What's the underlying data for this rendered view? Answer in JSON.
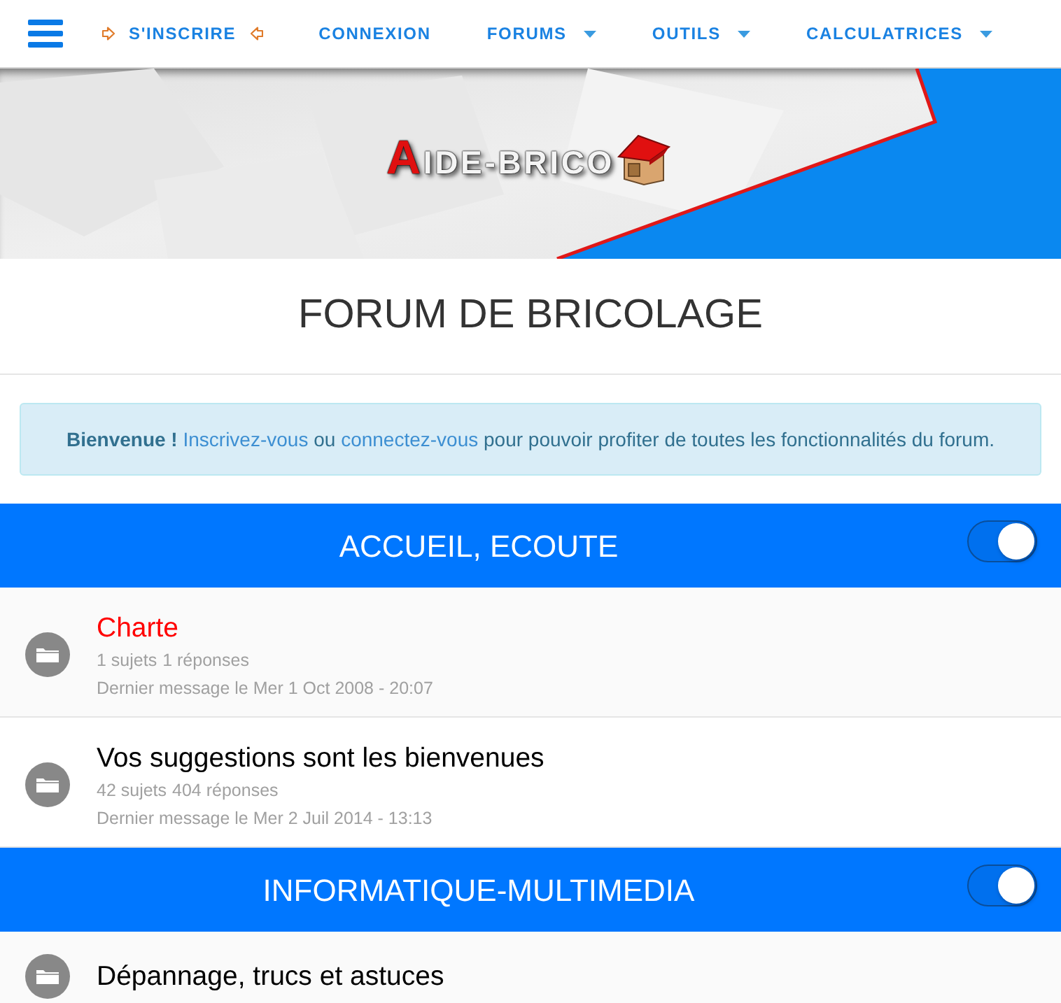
{
  "nav": {
    "items": [
      {
        "kind": "arrowed",
        "label": "S'INSCRIRE"
      },
      {
        "kind": "link",
        "label": "CONNEXION"
      },
      {
        "kind": "dropdown",
        "label": "FORUMS"
      },
      {
        "kind": "dropdown",
        "label": "OUTILS"
      },
      {
        "kind": "dropdown",
        "label": "CALCULATRICES"
      }
    ]
  },
  "banner": {
    "logo": "AIDE-BRICO"
  },
  "title": "FORUM DE BRICOLAGE",
  "welcome": [
    {
      "kind": "bold",
      "text": "Bienvenue !"
    },
    {
      "kind": "link",
      "text": "Inscrivez-vous"
    },
    {
      "kind": "text",
      "text": "ou"
    },
    {
      "kind": "link",
      "text": "connectez-vous"
    },
    {
      "kind": "text",
      "text": "pour pouvoir profiter de toutes les fonctionnalités du forum."
    }
  ],
  "categories": [
    {
      "title": "ACCUEIL, ECOUTE",
      "expanded": true,
      "forums": [
        {
          "title": "Charte",
          "color": "#ff0000",
          "topics": "1 sujets",
          "replies": "1 réponses",
          "last_post": "Dernier message le Mer 1 Oct 2008 - 20:07"
        },
        {
          "title": "Vos suggestions sont les bienvenues",
          "color": "#000000",
          "topics": "42 sujets",
          "replies": "404 réponses",
          "last_post": "Dernier message le Mer 2 Juil 2014 - 13:13"
        }
      ]
    },
    {
      "title": "INFORMATIQUE-MULTIMEDIA",
      "expanded": true,
      "forums": [
        {
          "title": "Dépannage, trucs et astuces",
          "color": "#000000"
        }
      ]
    }
  ]
}
